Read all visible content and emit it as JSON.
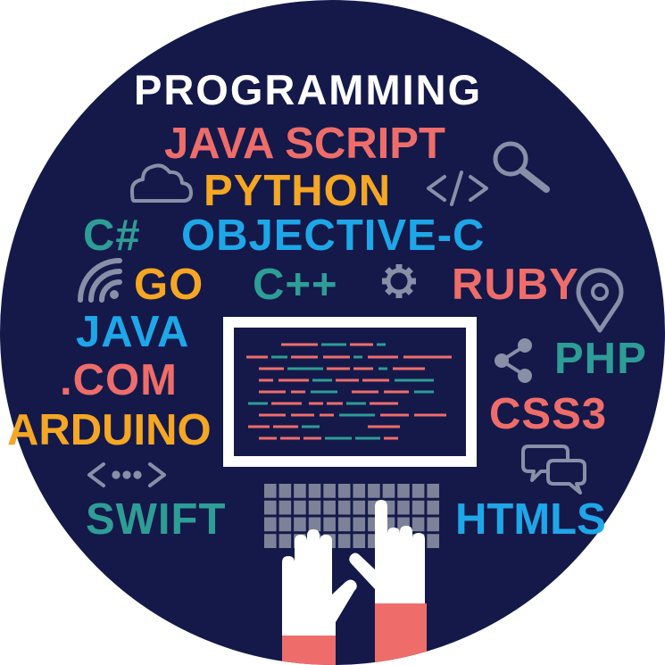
{
  "palette": {
    "background": "#ffffff",
    "circle": "#14194a",
    "white": "#ffffff",
    "salmon": "#ee6d6a",
    "orange": "#f5a623",
    "teal": "#2e9d96",
    "blue": "#1ea7e8",
    "gray": "#8a8fa8",
    "key": "#7e8298",
    "sleeve": "#ee6d6a"
  },
  "title": "PROGRAMMING",
  "languages": {
    "javascript": "JAVA SCRIPT",
    "python": "PYTHON",
    "csharp": "C#",
    "objective_c": "OBJECTIVE-C",
    "go": "GO",
    "cpp": "C++",
    "ruby": "RUBY",
    "java": "JAVA",
    "dotcom": ".COM",
    "php": "PHP",
    "arduino": "ARDUINO",
    "css3": "CSS3",
    "swift": "SWIFT",
    "html5": "HTMLS"
  },
  "icons": {
    "cloud": "cloud-icon",
    "search": "search-icon",
    "code": "code-brackets-icon",
    "wifi": "wifi-icon",
    "gear": "gear-icon",
    "pin": "location-pin-icon",
    "share": "share-icon",
    "chat": "chat-bubbles-icon",
    "ellipsis": "code-ellipsis-icon",
    "monitor": "monitor-icon",
    "keyboard": "keyboard-icon",
    "hands": "typing-hands-icon"
  }
}
